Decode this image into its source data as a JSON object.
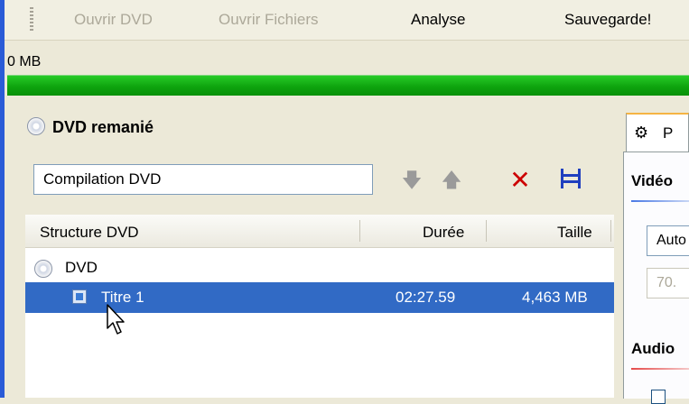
{
  "toolbar": {
    "open_dvd": "Ouvrir DVD",
    "open_files": "Ouvrir Fichiers",
    "analyse": "Analyse",
    "save": "Sauvegarde!"
  },
  "status": {
    "size": "0 MB",
    "progress_fraction": 1.0
  },
  "left_panel": {
    "title": "DVD remanié",
    "compilation_value": "Compilation DVD",
    "columns": [
      "Structure DVD",
      "Durée",
      "Taille"
    ],
    "rows": [
      {
        "name": "DVD",
        "duration": "",
        "size": ""
      },
      {
        "name": "Titre 1",
        "duration": "02:27.59",
        "size": "4,463 MB"
      }
    ]
  },
  "right_panel": {
    "tab_label": "P",
    "video_label": "Vidéo",
    "field1": "Auto",
    "field2": "70.",
    "audio_label": "Audio"
  },
  "colors": {
    "progress": "#0ea40e",
    "selection": "#316ac5",
    "delete": "#cc0000",
    "accent": "#1f3fbf"
  }
}
